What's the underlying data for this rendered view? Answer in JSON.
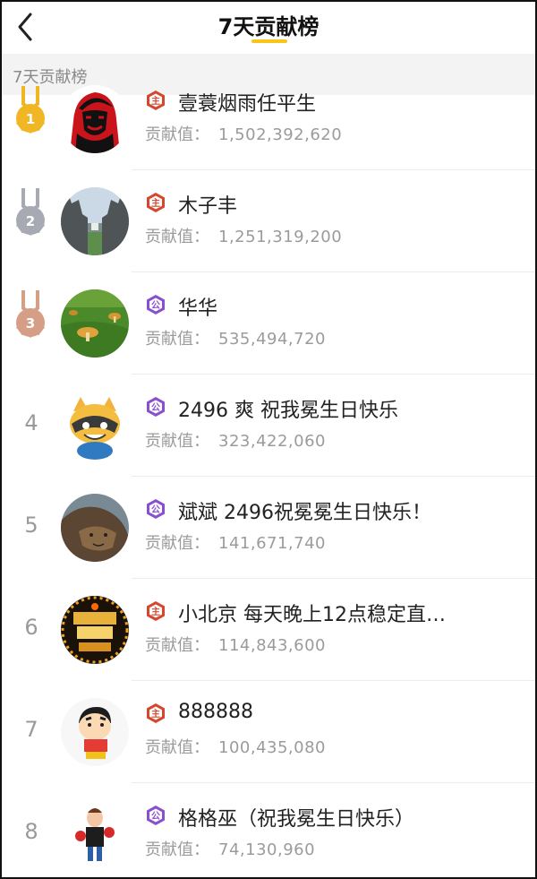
{
  "header": {
    "back_icon": "chevron-left-icon",
    "title": "7天贡献榜",
    "accent_color": "#f8c51c"
  },
  "section": {
    "label": "7天贡献榜"
  },
  "contribution_label": "贡献值：",
  "level_badges": {
    "主": {
      "color": "#d4462e",
      "text": "主"
    },
    "公": {
      "color": "#8a4fd0",
      "text": "公"
    }
  },
  "medal_colors": {
    "1": "#f0b624",
    "2": "#a7aab2",
    "3": "#d59f87"
  },
  "ranking": [
    {
      "rank": "1",
      "medal": true,
      "badge": "主",
      "name": "壹蓑烟雨任平生",
      "value": "1,502,392,620",
      "avatar": "che-portrait-avatar"
    },
    {
      "rank": "2",
      "medal": true,
      "badge": "主",
      "name": "木子丰",
      "value": "1,251,319,200",
      "avatar": "temple-gate-avatar"
    },
    {
      "rank": "3",
      "medal": true,
      "badge": "公",
      "name": "华华",
      "value": "535,494,720",
      "avatar": "mushroom-grass-avatar"
    },
    {
      "rank": "4",
      "medal": false,
      "badge": "公",
      "name": "2496  爽  祝我冕生日快乐",
      "value": "323,422,060",
      "avatar": "raccoon-cartoon-avatar"
    },
    {
      "rank": "5",
      "medal": false,
      "badge": "公",
      "name": "斌斌 2496祝冕冕生日快乐！",
      "value": "141,671,740",
      "avatar": "lion-avatar"
    },
    {
      "rank": "6",
      "medal": false,
      "badge": "主",
      "name": "小北京   每天晚上12点稳定直…",
      "value": "114,843,600",
      "avatar": "beijing-king-avatar"
    },
    {
      "rank": "7",
      "medal": false,
      "badge": "主",
      "name": "888888",
      "value": "100,435,080",
      "avatar": "crayon-shin-avatar"
    },
    {
      "rank": "8",
      "medal": false,
      "badge": "公",
      "name": "格格巫（祝我冕生日快乐）",
      "value": "74,130,960",
      "avatar": "cartoon-boxer-avatar"
    }
  ]
}
